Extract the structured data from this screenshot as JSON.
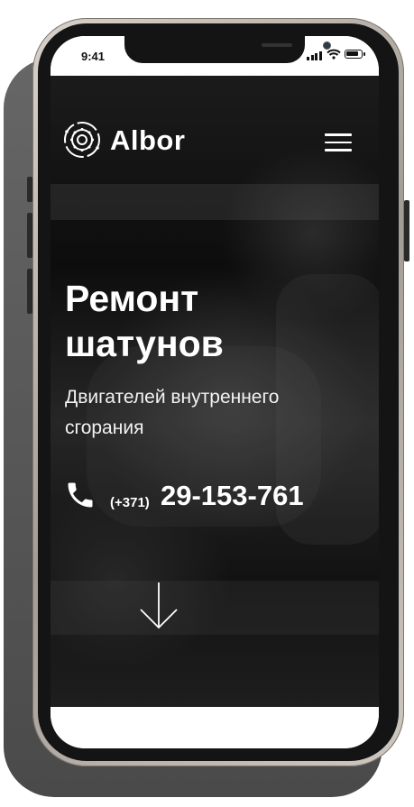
{
  "status_bar": {
    "time": "9:41"
  },
  "header": {
    "brand": "Albor",
    "logo_icon": "gear-circuit-icon",
    "menu_icon": "hamburger-menu-icon"
  },
  "hero": {
    "title_line1": "Ремонт",
    "title_line2": "шатунов",
    "subtitle_line1": "Двигателей внутреннего",
    "subtitle_line2": "сгорания",
    "phone_icon": "phone-icon",
    "phone_code": "(+371)",
    "phone_number": "29-153-761",
    "scroll_icon": "arrow-down-icon"
  },
  "colors": {
    "text": "#ffffff",
    "frame": "#c9c2ba",
    "background": "#111111"
  }
}
